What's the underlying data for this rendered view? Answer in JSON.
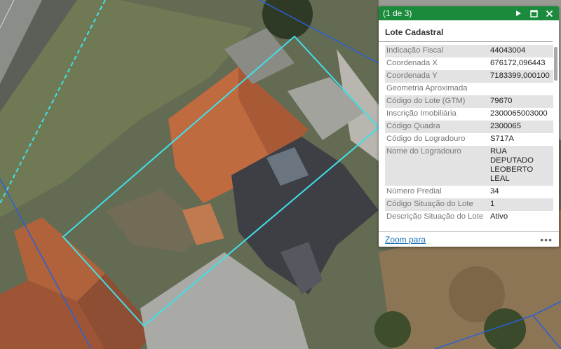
{
  "popup": {
    "counter": "(1 de 3)",
    "title": "Lote Cadastral",
    "accent_color": "#1a8a3c",
    "icons": {
      "next": "play-icon",
      "maximize": "maximize-icon",
      "close": "close-icon",
      "more": "ellipsis-icon"
    },
    "rows": [
      {
        "key": "Indicação Fiscal",
        "value": "44043004"
      },
      {
        "key": "Coordenada X",
        "value": "676172,096443"
      },
      {
        "key": "Coordenada Y",
        "value": "7183399,000100"
      },
      {
        "key": "Geometria Aproximada",
        "value": ""
      },
      {
        "key": "Código do Lote (GTM)",
        "value": "79670"
      },
      {
        "key": "Inscrição Imobiliária",
        "value": "2300065003000"
      },
      {
        "key": "Código Quadra",
        "value": "2300065"
      },
      {
        "key": "Código do Logradouro",
        "value": "S717A"
      },
      {
        "key": "Nome do Logradouro",
        "value": "RUA DEPUTADO LEOBERTO LEAL"
      },
      {
        "key": "Número Predial",
        "value": "34"
      },
      {
        "key": "Código Situação do Lote",
        "value": "1"
      },
      {
        "key": "Descrição Situação do Lote",
        "value": "Ativo"
      }
    ],
    "footer": {
      "zoom_label": "Zoom para",
      "more_label": "•••"
    }
  },
  "map": {
    "parcel_highlight_color": "#3fe0ea",
    "parcel_outline_color": "#2a5fd8"
  }
}
